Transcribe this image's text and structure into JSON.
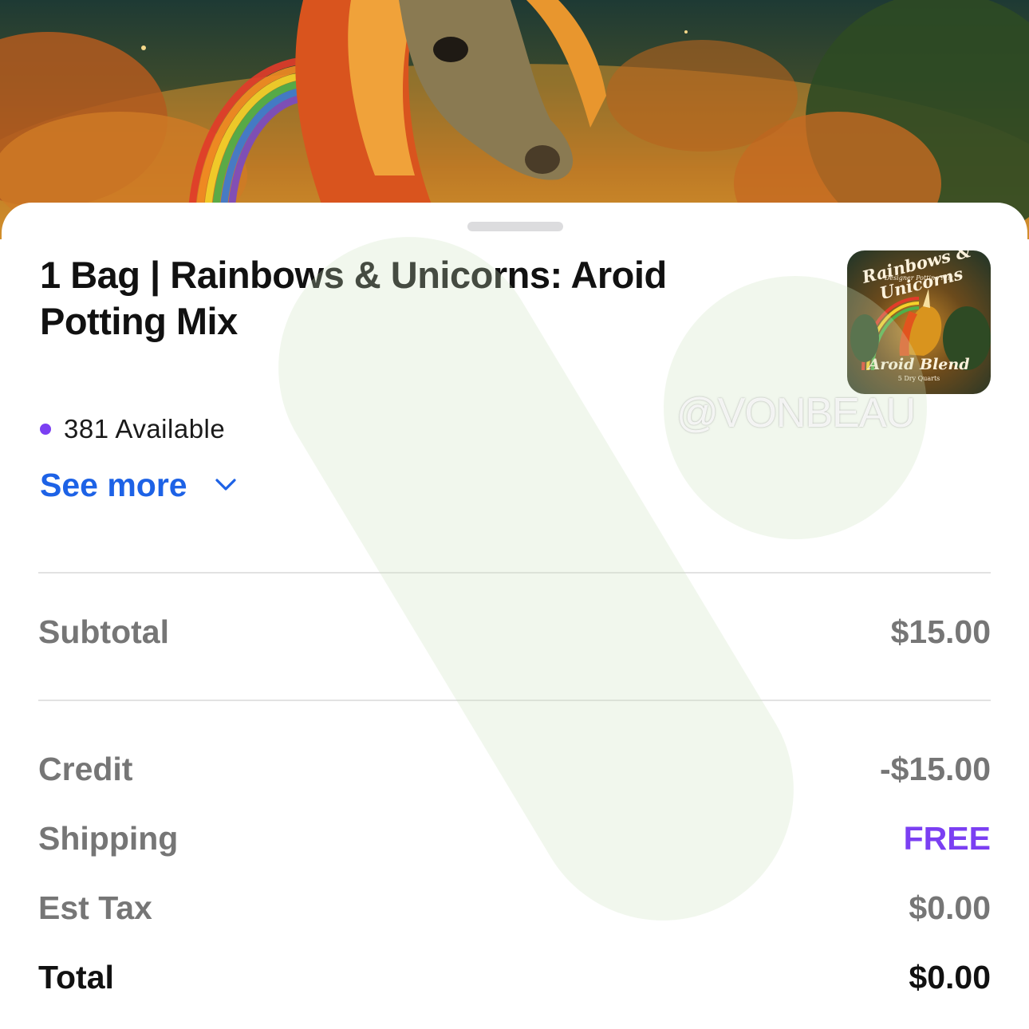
{
  "product": {
    "title": "1 Bag | Rainbows & Unicorns: Aroid Potting Mix",
    "availability": "381 Available",
    "see_more_label": "See more",
    "thumbnail": {
      "arch_text": "Rainbows & Unicorns",
      "subtitle": "Designer Potting Mix",
      "blend_text": "Aroid Blend",
      "quantity_text": "5 Dry Quarts"
    }
  },
  "summary": {
    "subtotal": {
      "label": "Subtotal",
      "value": "$15.00"
    },
    "credit": {
      "label": "Credit",
      "value": "-$15.00"
    },
    "shipping": {
      "label": "Shipping",
      "value": "FREE"
    },
    "tax": {
      "label": "Est Tax",
      "value": "$0.00"
    },
    "total": {
      "label": "Total",
      "value": "$0.00"
    }
  },
  "watermark": "@VONBEAU",
  "colors": {
    "accent_purple": "#7b3ff2",
    "link_blue": "#1d62e6",
    "muted_text": "#767676",
    "primary_text": "#111111"
  },
  "icons": {
    "availability_dot": "purple-dot",
    "see_more_chevron": "chevron-down-icon"
  }
}
